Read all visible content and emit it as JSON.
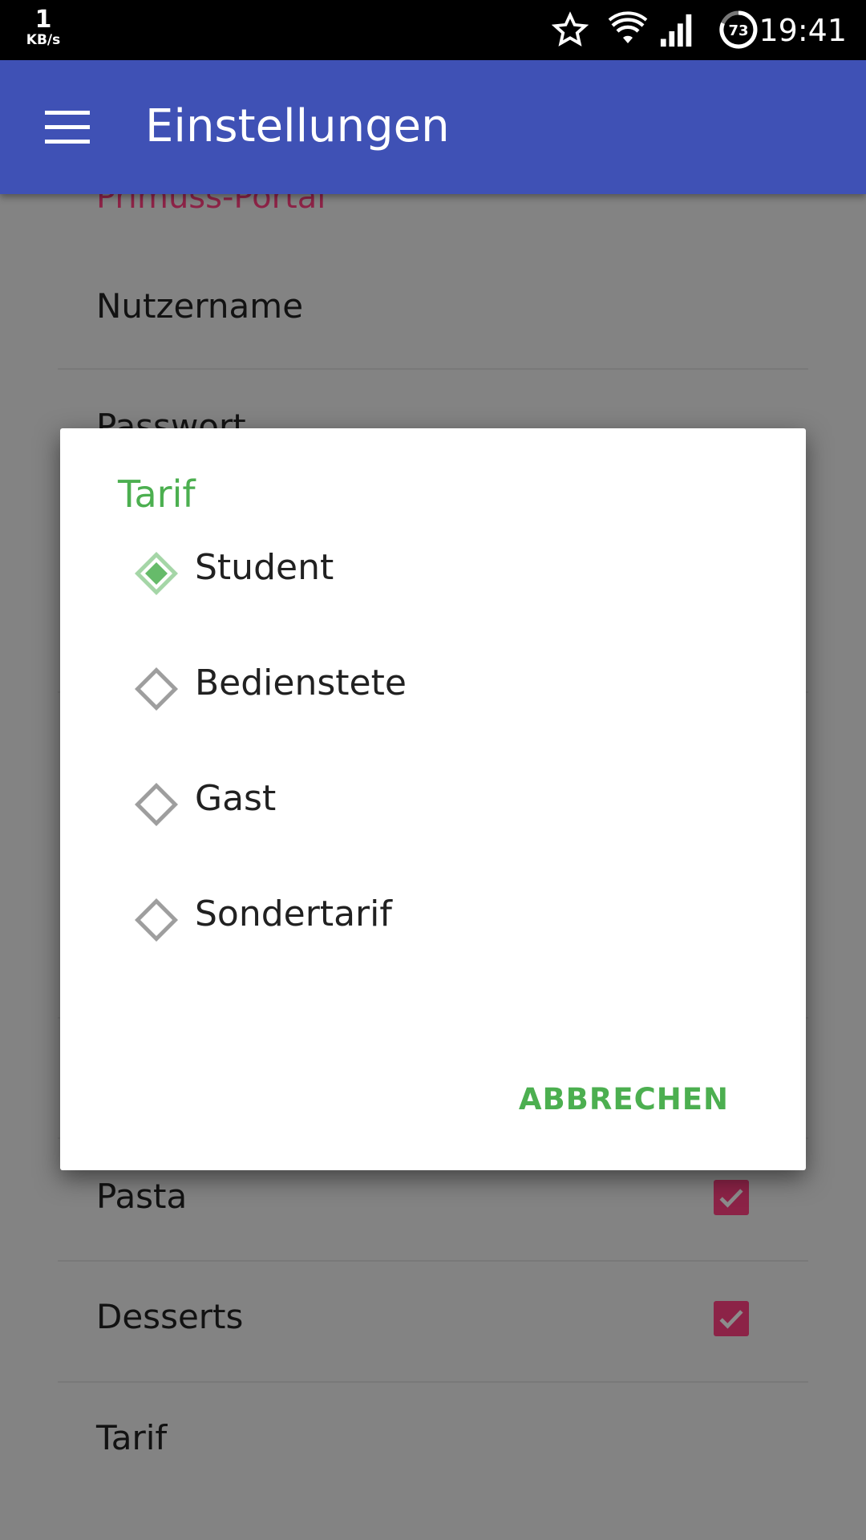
{
  "status_bar": {
    "speed_value": "1",
    "speed_unit": "KB/s",
    "time": "19:41",
    "battery_level": "73",
    "icons": [
      "star-icon",
      "wifi-icon",
      "signal-icon",
      "battery-icon"
    ]
  },
  "app_bar": {
    "title": "Einstellungen",
    "menu_icon": "hamburger-menu-icon",
    "color": "#3f51b5"
  },
  "settings": {
    "category_label": "Primuss-Portal",
    "items": [
      {
        "label": "Nutzername"
      },
      {
        "label": "Passwort"
      },
      {
        "label": "Pasta",
        "checked": true
      },
      {
        "label": "Desserts",
        "checked": true
      },
      {
        "label": "Tarif"
      }
    ]
  },
  "dialog": {
    "title": "Tarif",
    "options": [
      {
        "label": "Student",
        "selected": true
      },
      {
        "label": "Bedienstete",
        "selected": false
      },
      {
        "label": "Gast",
        "selected": false
      },
      {
        "label": "Sondertarif",
        "selected": false
      }
    ],
    "cancel_label": "ABBRECHEN",
    "accent": "#4caf50"
  },
  "colors": {
    "checkbox": "#ff4081",
    "category": "#ff4081"
  }
}
